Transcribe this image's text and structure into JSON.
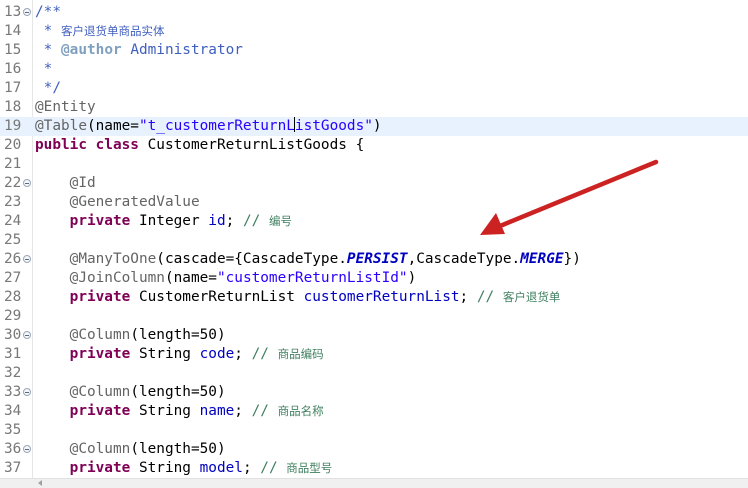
{
  "editor": {
    "lines": [
      {
        "n": "13",
        "fold": true,
        "current": false,
        "tokens": [
          {
            "t": "/**",
            "c": "cm"
          }
        ]
      },
      {
        "n": "14",
        "fold": false,
        "current": false,
        "tokens": [
          {
            "t": " * ",
            "c": "cm"
          },
          {
            "t": "客户退货单商品实体",
            "c": "cm cjk"
          }
        ]
      },
      {
        "n": "15",
        "fold": false,
        "current": false,
        "tokens": [
          {
            "t": " * ",
            "c": "cm"
          },
          {
            "t": "@author",
            "c": "cm-tag"
          },
          {
            "t": " Administrator",
            "c": "cm"
          }
        ]
      },
      {
        "n": "16",
        "fold": false,
        "current": false,
        "tokens": [
          {
            "t": " *",
            "c": "cm"
          }
        ]
      },
      {
        "n": "17",
        "fold": false,
        "current": false,
        "tokens": [
          {
            "t": " */",
            "c": "cm"
          }
        ]
      },
      {
        "n": "18",
        "fold": false,
        "current": false,
        "tokens": [
          {
            "t": "@Entity",
            "c": "ann"
          }
        ]
      },
      {
        "n": "19",
        "fold": false,
        "current": true,
        "tokens": [
          {
            "t": "@Table",
            "c": "ann"
          },
          {
            "t": "(name=",
            "c": ""
          },
          {
            "t": "\"t_customerReturnL",
            "c": "str"
          },
          {
            "t": "",
            "c": "caret"
          },
          {
            "t": "istGoods\"",
            "c": "str"
          },
          {
            "t": ")",
            "c": ""
          }
        ]
      },
      {
        "n": "20",
        "fold": false,
        "current": false,
        "tokens": [
          {
            "t": "public class",
            "c": "kw"
          },
          {
            "t": " CustomerReturnListGoods {",
            "c": ""
          }
        ]
      },
      {
        "n": "21",
        "fold": false,
        "current": false,
        "tokens": []
      },
      {
        "n": "22",
        "fold": true,
        "current": false,
        "tokens": [
          {
            "t": "    ",
            "c": ""
          },
          {
            "t": "@Id",
            "c": "ann"
          }
        ]
      },
      {
        "n": "23",
        "fold": false,
        "current": false,
        "tokens": [
          {
            "t": "    ",
            "c": ""
          },
          {
            "t": "@GeneratedValue",
            "c": "ann"
          }
        ]
      },
      {
        "n": "24",
        "fold": false,
        "current": false,
        "tokens": [
          {
            "t": "    ",
            "c": ""
          },
          {
            "t": "private",
            "c": "kw"
          },
          {
            "t": " Integer ",
            "c": ""
          },
          {
            "t": "id",
            "c": "fld"
          },
          {
            "t": "; ",
            "c": ""
          },
          {
            "t": "// ",
            "c": "lc"
          },
          {
            "t": "编号",
            "c": "lc cjk"
          }
        ]
      },
      {
        "n": "25",
        "fold": false,
        "current": false,
        "tokens": []
      },
      {
        "n": "26",
        "fold": true,
        "current": false,
        "tokens": [
          {
            "t": "    ",
            "c": ""
          },
          {
            "t": "@ManyToOne",
            "c": "ann"
          },
          {
            "t": "(cascade={CascadeType.",
            "c": ""
          },
          {
            "t": "PERSIST",
            "c": "sfld"
          },
          {
            "t": ",CascadeType.",
            "c": ""
          },
          {
            "t": "MERGE",
            "c": "sfld"
          },
          {
            "t": "})",
            "c": ""
          }
        ]
      },
      {
        "n": "27",
        "fold": false,
        "current": false,
        "tokens": [
          {
            "t": "    ",
            "c": ""
          },
          {
            "t": "@JoinColumn",
            "c": "ann"
          },
          {
            "t": "(name=",
            "c": ""
          },
          {
            "t": "\"customerReturnListId\"",
            "c": "str"
          },
          {
            "t": ")",
            "c": ""
          }
        ]
      },
      {
        "n": "28",
        "fold": false,
        "current": false,
        "tokens": [
          {
            "t": "    ",
            "c": ""
          },
          {
            "t": "private",
            "c": "kw"
          },
          {
            "t": " CustomerReturnList ",
            "c": ""
          },
          {
            "t": "customerReturnList",
            "c": "fld"
          },
          {
            "t": "; ",
            "c": ""
          },
          {
            "t": "// ",
            "c": "lc"
          },
          {
            "t": "客户退货单",
            "c": "lc cjk"
          }
        ]
      },
      {
        "n": "29",
        "fold": false,
        "current": false,
        "tokens": []
      },
      {
        "n": "30",
        "fold": true,
        "current": false,
        "tokens": [
          {
            "t": "    ",
            "c": ""
          },
          {
            "t": "@Column",
            "c": "ann"
          },
          {
            "t": "(length=50)",
            "c": ""
          }
        ]
      },
      {
        "n": "31",
        "fold": false,
        "current": false,
        "tokens": [
          {
            "t": "    ",
            "c": ""
          },
          {
            "t": "private",
            "c": "kw"
          },
          {
            "t": " String ",
            "c": ""
          },
          {
            "t": "code",
            "c": "fld"
          },
          {
            "t": "; ",
            "c": ""
          },
          {
            "t": "// ",
            "c": "lc"
          },
          {
            "t": "商品编码",
            "c": "lc cjk"
          }
        ]
      },
      {
        "n": "32",
        "fold": false,
        "current": false,
        "tokens": []
      },
      {
        "n": "33",
        "fold": true,
        "current": false,
        "tokens": [
          {
            "t": "    ",
            "c": ""
          },
          {
            "t": "@Column",
            "c": "ann"
          },
          {
            "t": "(length=50)",
            "c": ""
          }
        ]
      },
      {
        "n": "34",
        "fold": false,
        "current": false,
        "tokens": [
          {
            "t": "    ",
            "c": ""
          },
          {
            "t": "private",
            "c": "kw"
          },
          {
            "t": " String ",
            "c": ""
          },
          {
            "t": "name",
            "c": "fld"
          },
          {
            "t": "; ",
            "c": ""
          },
          {
            "t": "// ",
            "c": "lc"
          },
          {
            "t": "商品名称",
            "c": "lc cjk"
          }
        ]
      },
      {
        "n": "35",
        "fold": false,
        "current": false,
        "tokens": []
      },
      {
        "n": "36",
        "fold": true,
        "current": false,
        "tokens": [
          {
            "t": "    ",
            "c": ""
          },
          {
            "t": "@Column",
            "c": "ann"
          },
          {
            "t": "(length=50)",
            "c": ""
          }
        ]
      },
      {
        "n": "37",
        "fold": false,
        "current": false,
        "tokens": [
          {
            "t": "    ",
            "c": ""
          },
          {
            "t": "private",
            "c": "kw"
          },
          {
            "t": " String ",
            "c": ""
          },
          {
            "t": "model",
            "c": "fld"
          },
          {
            "t": "; ",
            "c": ""
          },
          {
            "t": "// ",
            "c": "lc"
          },
          {
            "t": "商品型号",
            "c": "lc cjk"
          }
        ]
      }
    ]
  },
  "annotation_arrow": {
    "color": "#cc2222",
    "icon": "red-arrow-icon"
  },
  "colors": {
    "keyword": "#7f0055",
    "string": "#2a00ff",
    "annotation": "#646464",
    "comment": "#3f5fbf",
    "line_comment": "#3f7f5f",
    "field": "#0000c0",
    "current_line": "#e8f2fe"
  }
}
